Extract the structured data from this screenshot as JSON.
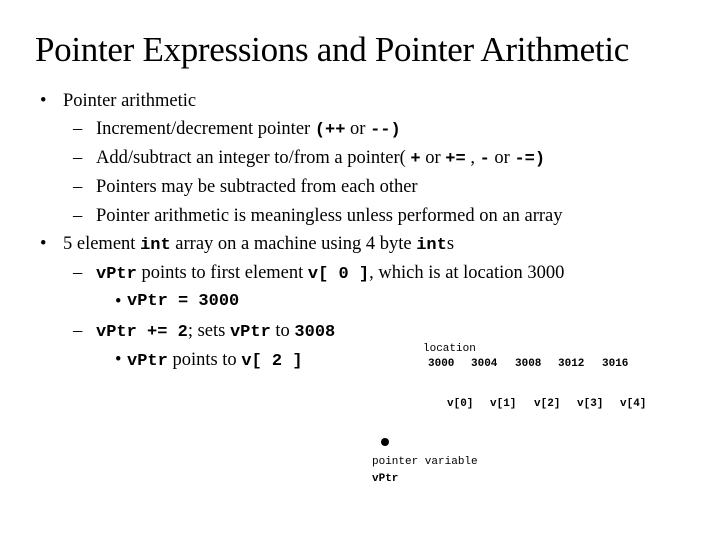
{
  "title": "Pointer Expressions and Pointer Arithmetic",
  "bullets": {
    "b1": {
      "mark": "•",
      "text": "Pointer arithmetic"
    },
    "b1_1": {
      "mark": "–",
      "pre": "Increment/decrement pointer   ",
      "code1": "(++",
      "mid": " or ",
      "code2": "--)"
    },
    "b1_2": {
      "mark": "–",
      "pre": "Add/subtract an integer to/from a pointer( ",
      "c1": "+",
      "t1": " or ",
      "c2": "+=",
      "t2": " , ",
      "c3": "-",
      "t3": " or ",
      "c4": "-=)"
    },
    "b1_3": {
      "mark": "–",
      "text": "Pointers may be subtracted from each other"
    },
    "b1_4": {
      "mark": "–",
      "text": "Pointer arithmetic is meaningless unless performed on an array"
    },
    "b2": {
      "mark": "•",
      "t1": "5 element ",
      "c1": "int",
      "t2": " array on a machine using 4 byte ",
      "c2": "int",
      "t3": "s"
    },
    "b2_1": {
      "mark": "–",
      "c1": "vPtr",
      "t1": " points to first element ",
      "c2": "v[ 0 ]",
      "t2": ", which is at location 3000"
    },
    "b2_1_1": {
      "mark": "•",
      "code": "vPtr = 3000"
    },
    "b2_2": {
      "mark": "–",
      "c1": "vPtr += 2",
      "t1": "; sets ",
      "c2": "vPtr",
      "t2": " to ",
      "c3": "3008"
    },
    "b2_2_1": {
      "mark": "•",
      "c1": "vPtr",
      "t1": " points to ",
      "c2": "v[ 2 ]"
    }
  },
  "diagram": {
    "location_label": "location",
    "addresses": [
      "3000",
      "3004",
      "3008",
      "3012",
      "3016"
    ],
    "elements": [
      "v[0]",
      "v[1]",
      "v[2]",
      "v[3]",
      "v[4]"
    ],
    "pointer_label": "pointer variable",
    "pointer_name": "vPtr"
  }
}
